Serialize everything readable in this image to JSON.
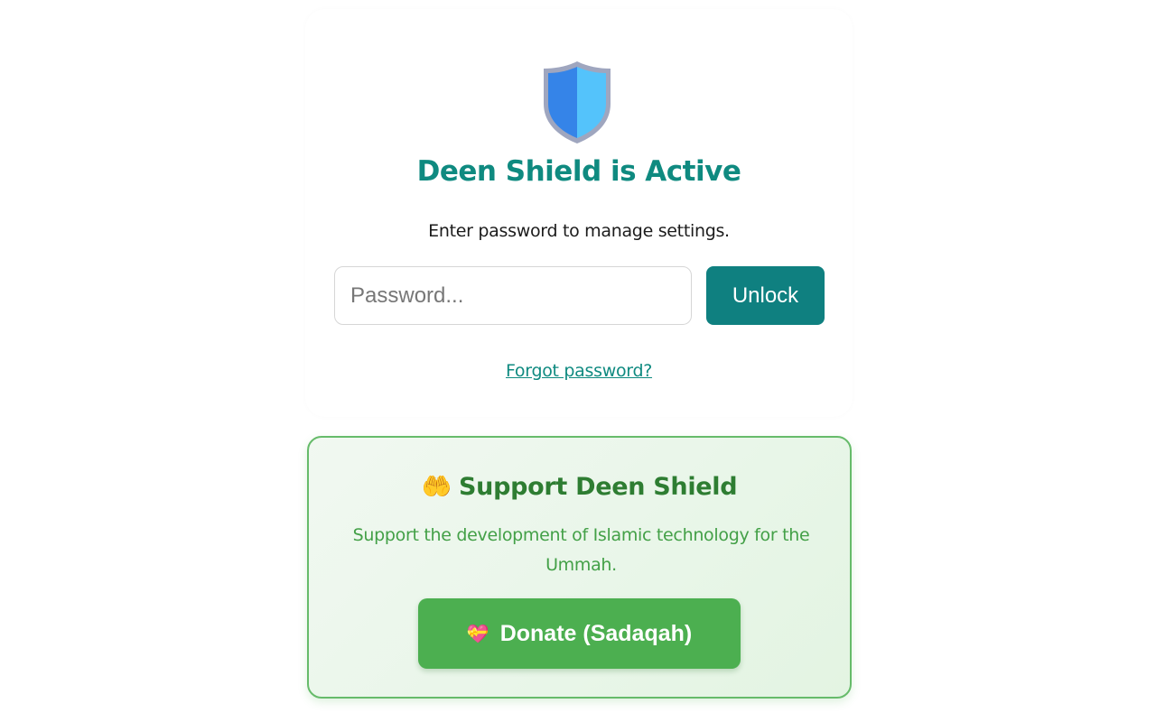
{
  "lock_card": {
    "title": "Deen Shield is Active",
    "subtitle": "Enter password to manage settings.",
    "password_placeholder": "Password...",
    "unlock_label": "Unlock",
    "forgot_label": "Forgot password?",
    "shield_icon": "shield-icon"
  },
  "support": {
    "icon": "🤲",
    "title": "Support Deen Shield",
    "description": "Support the development of Islamic technology for the Ummah.",
    "donate_icon": "💝",
    "donate_label": "Donate (Sadaqah)"
  },
  "colors": {
    "accent": "#0f8080",
    "title": "#0f8a80",
    "support_title": "#2e7d32",
    "support_text": "#43a047",
    "donate_button": "#4caf50",
    "support_border": "#66bb6a"
  }
}
